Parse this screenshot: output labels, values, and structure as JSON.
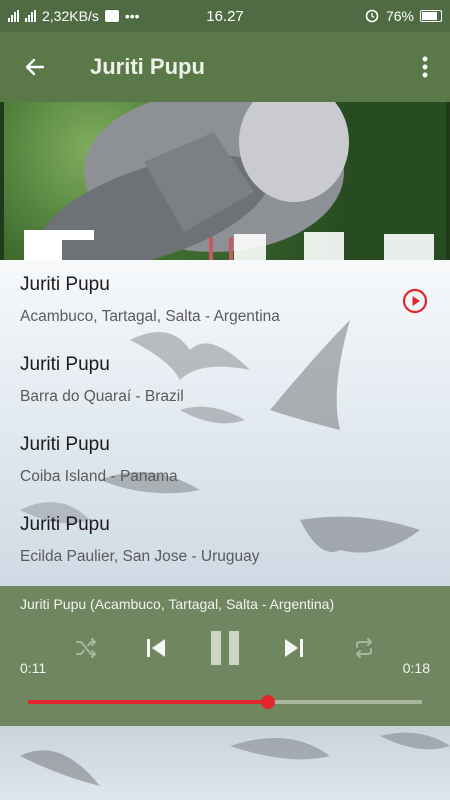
{
  "status_bar": {
    "net_speed": "2,32KB/s",
    "time": "16.27",
    "battery": "76%",
    "battery_level": 0.76
  },
  "app_bar": {
    "title": "Juriti Pupu",
    "back_icon": "arrow-left-icon",
    "menu_icon": "more-vert-icon"
  },
  "tracks": [
    {
      "title": "Juriti Pupu",
      "location": "Acambuco, Tartagal, Salta - Argentina",
      "playing": true
    },
    {
      "title": "Juriti Pupu",
      "location": "Barra do Quaraí - Brazil"
    },
    {
      "title": "Juriti Pupu",
      "location": "Coiba Island - Panama"
    },
    {
      "title": "Juriti Pupu",
      "location": "Ecilda Paulier, San Jose - Uruguay"
    }
  ],
  "player": {
    "now_playing": "Juriti Pupu (Acambuco, Tartagal, Salta - Argentina)",
    "current_time": "0:11",
    "total_time": "0:18",
    "progress": 0.61,
    "accent_color": "#e3262b"
  }
}
